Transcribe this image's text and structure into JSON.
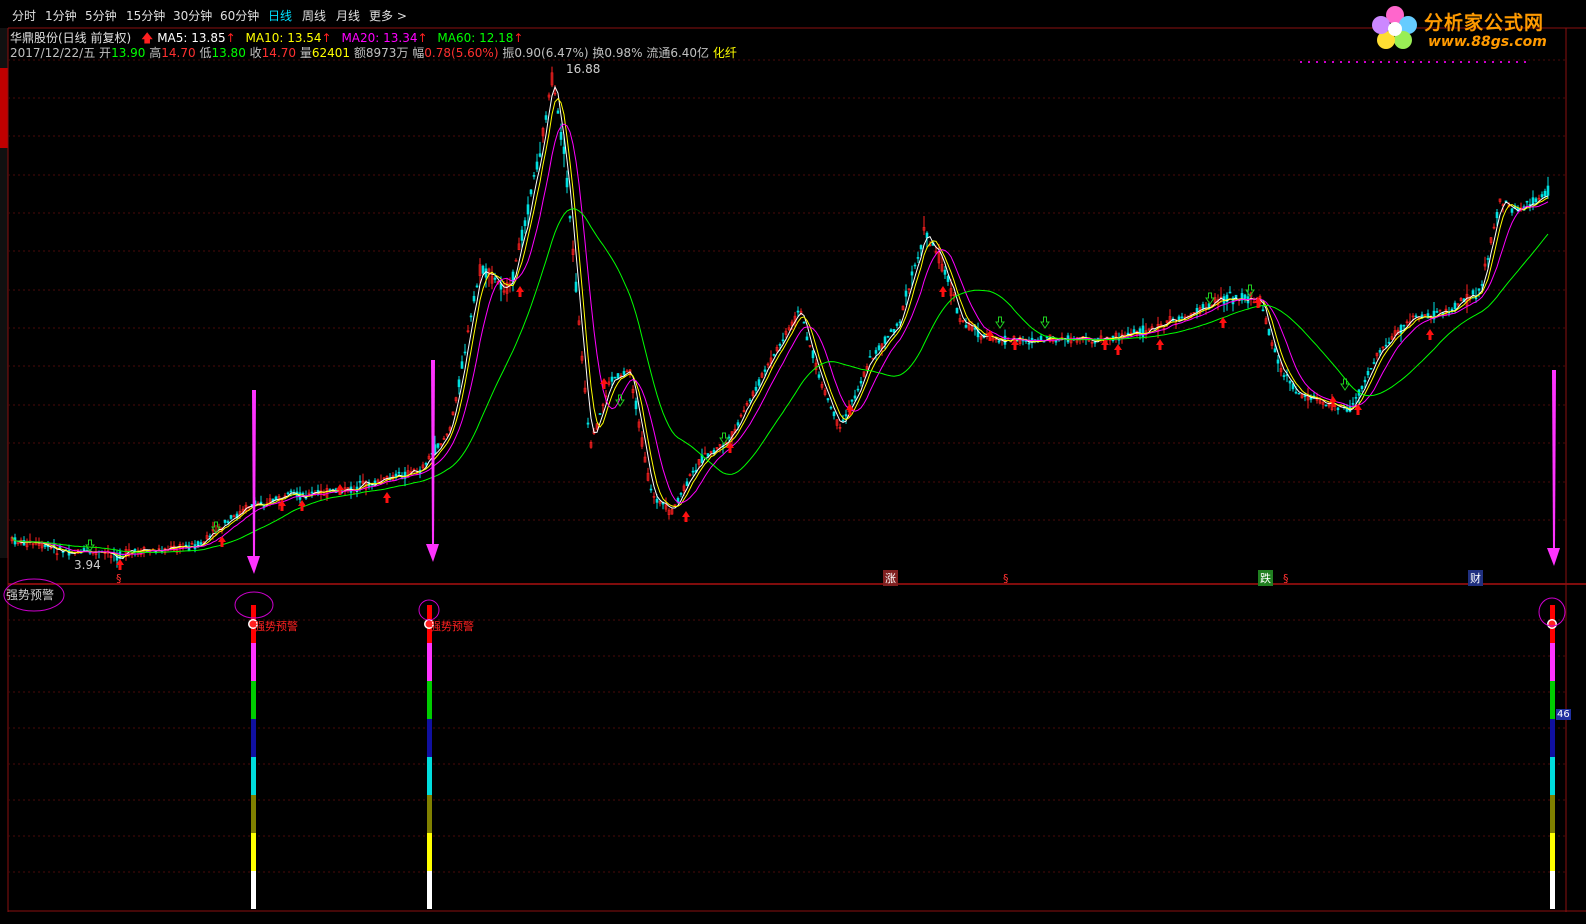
{
  "toolbar": {
    "items": [
      "分时",
      "1分钟",
      "5分钟",
      "15分钟",
      "30分钟",
      "60分钟",
      "日线",
      "周线",
      "月线",
      "更多 >"
    ],
    "active": "日线"
  },
  "stock": {
    "title": "华鼎股份(日线 前复权)",
    "ma": [
      {
        "label": "MA5: 13.85",
        "color": "#ffffff"
      },
      {
        "label": "MA10: 13.54",
        "color": "#ffff00"
      },
      {
        "label": "MA20: 13.34",
        "color": "#ff00ff"
      },
      {
        "label": "MA60: 12.18",
        "color": "#00ff00"
      }
    ],
    "date": "2017/12/22/五",
    "open_label": "开",
    "open": "13.90",
    "high_label": "高",
    "high": "14.70",
    "low_label": "低",
    "low": "13.80",
    "close_label": "收",
    "close": "14.70",
    "volume_label": "量",
    "volume": "62401",
    "amount_label": "额",
    "amount": "8973万",
    "change_label": "幅",
    "change": "0.78(5.60%)",
    "amplitude": "振0.90(6.47%)",
    "turnover": "换0.98%",
    "float_cap": "流通6.40亿",
    "industry": "化纤"
  },
  "price_annotations": {
    "max": "16.88",
    "min": "3.94"
  },
  "event_markers": [
    {
      "label": "§",
      "color": "#ff3030",
      "bg": ""
    },
    {
      "label": "涨",
      "color": "#ffffff",
      "bg": "#802020"
    },
    {
      "label": "§",
      "color": "#ff3030",
      "bg": ""
    },
    {
      "label": "跌",
      "color": "#ffffff",
      "bg": "#208020"
    },
    {
      "label": "§",
      "color": "#ff3030",
      "bg": ""
    },
    {
      "label": "财",
      "color": "#ffffff",
      "bg": "#203080"
    }
  ],
  "indicator": {
    "name": "强势预警",
    "signal_label": "强势预警",
    "value_badge": "46"
  },
  "watermark": {
    "text": "分析家公式网",
    "url": "www.88gs.com"
  },
  "colors": {
    "ma5": "#ffffff",
    "ma10": "#ffff00",
    "ma20": "#ff00ff",
    "ma60": "#00ff00",
    "up": "#ff2020",
    "down": "#00e0e0",
    "grid": "#5a1010",
    "arrow": "#ff33ff"
  }
}
